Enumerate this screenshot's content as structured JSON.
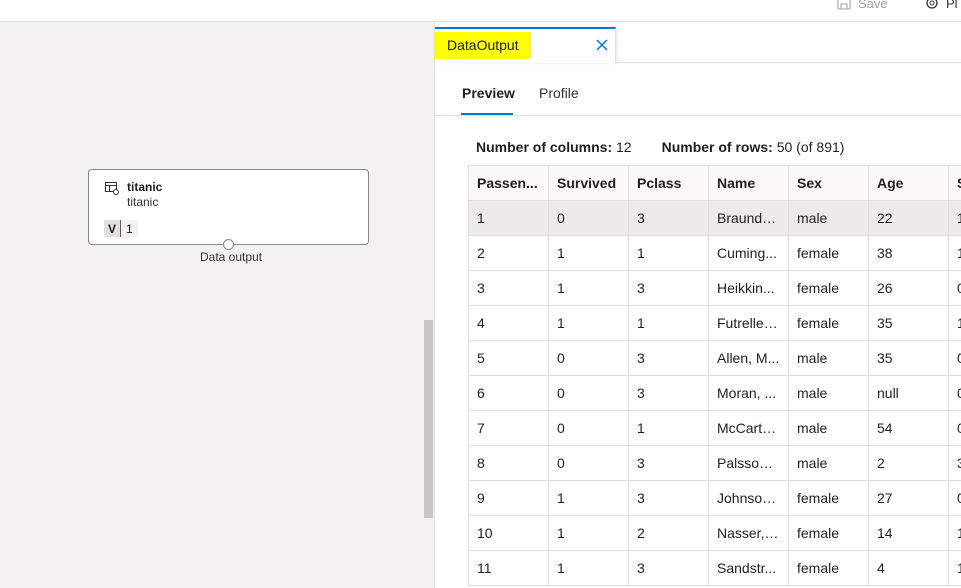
{
  "toolbar": {
    "save_label": "Save",
    "publish_label": "Pl"
  },
  "node": {
    "title": "titanic",
    "subtitle": "titanic",
    "version_prefix": "V",
    "version_number": "1",
    "port_label": "Data output"
  },
  "panel": {
    "tab_label": "DataOutput",
    "pivots": [
      "Preview",
      "Profile"
    ],
    "columns_label": "Number of columns:",
    "columns_value": "12",
    "rows_label": "Number of rows:",
    "rows_value": "50 (of 891)"
  },
  "table": {
    "headers": [
      "Passen...",
      "Survived",
      "Pclass",
      "Name",
      "Sex",
      "Age",
      "S"
    ],
    "rows": [
      [
        "1",
        "0",
        "3",
        "Braund, ...",
        "male",
        "22",
        "1"
      ],
      [
        "2",
        "1",
        "1",
        "Cuming...",
        "female",
        "38",
        "1"
      ],
      [
        "3",
        "1",
        "3",
        "Heikkin...",
        "female",
        "26",
        "0"
      ],
      [
        "4",
        "1",
        "1",
        "Futrelle, ...",
        "female",
        "35",
        "1"
      ],
      [
        "5",
        "0",
        "3",
        "Allen, M...",
        "male",
        "35",
        "0"
      ],
      [
        "6",
        "0",
        "3",
        "Moran, ...",
        "male",
        "null",
        "0"
      ],
      [
        "7",
        "0",
        "1",
        "McCarth...",
        "male",
        "54",
        "0"
      ],
      [
        "8",
        "0",
        "3",
        "Palsson,...",
        "male",
        "2",
        "3"
      ],
      [
        "9",
        "1",
        "3",
        "Johnson...",
        "female",
        "27",
        "0"
      ],
      [
        "10",
        "1",
        "2",
        "Nasser, ...",
        "female",
        "14",
        "1"
      ],
      [
        "11",
        "1",
        "3",
        "Sandstr...",
        "female",
        "4",
        "1"
      ]
    ]
  },
  "colors": {
    "accent": "#0078d4",
    "highlight": "#ffff00",
    "canvas_bg": "#f3f2f1"
  }
}
